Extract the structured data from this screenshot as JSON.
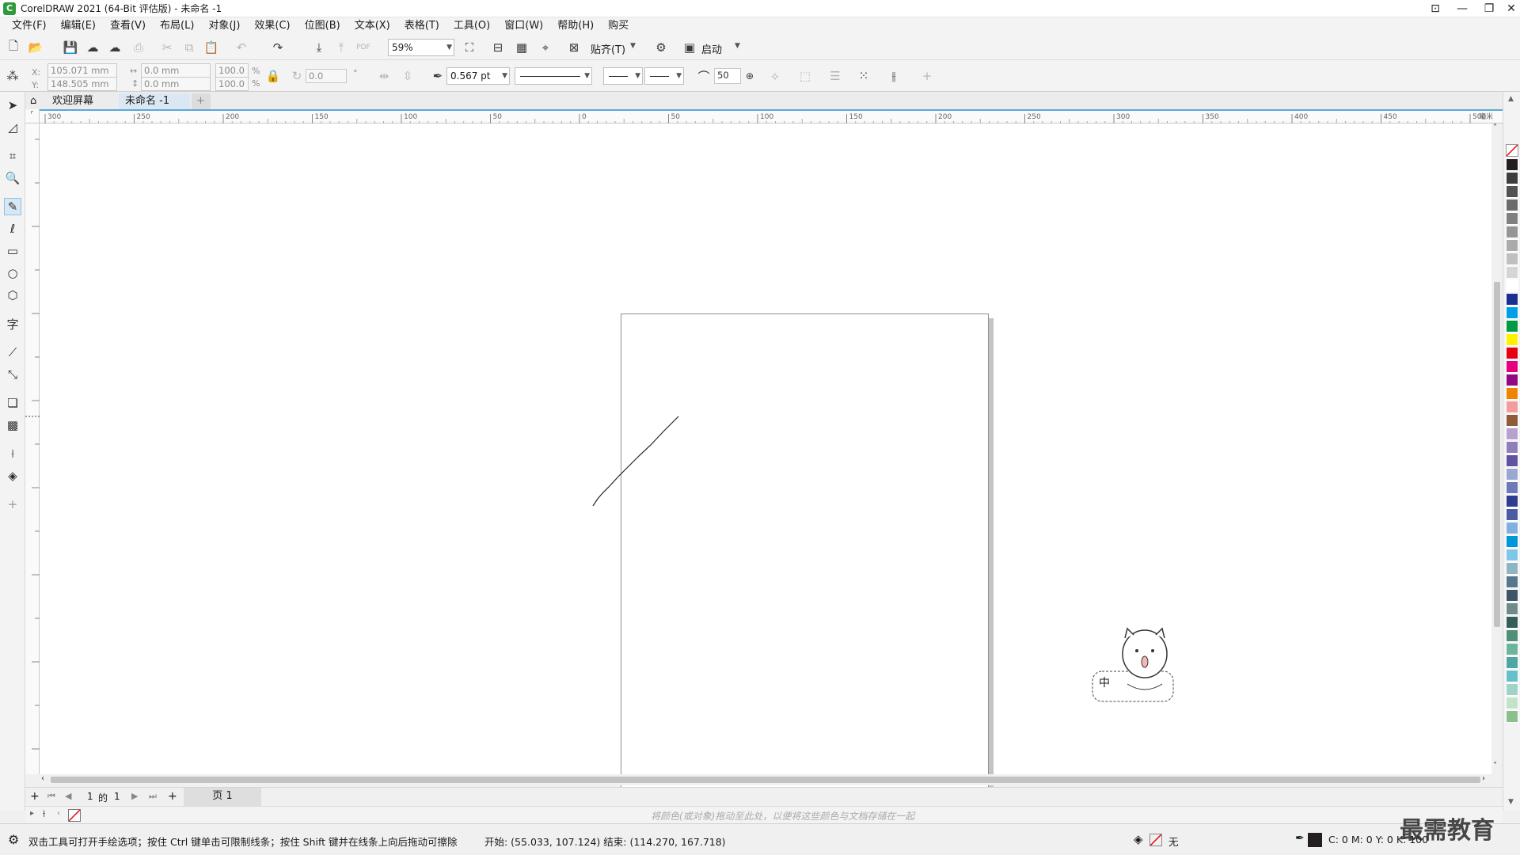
{
  "window": {
    "title": "CorelDRAW 2021 (64-Bit 评估版) - 未命名 -1",
    "min_icon": "minimize-icon",
    "max_icon": "restore-icon",
    "close_icon": "close-icon"
  },
  "menu": [
    "文件(F)",
    "编辑(E)",
    "查看(V)",
    "布局(L)",
    "对象(J)",
    "效果(C)",
    "位图(B)",
    "文本(X)",
    "表格(T)",
    "工具(O)",
    "窗口(W)",
    "帮助(H)",
    "购买"
  ],
  "toolbar": {
    "zoom": "59%",
    "snap_label": "贴齐(T)",
    "launch_label": "启动"
  },
  "property_bar": {
    "x": "105.071 mm",
    "y": "148.505 mm",
    "w": "0.0 mm",
    "h": "0.0 mm",
    "scale_x": "100.0",
    "scale_y": "100.0",
    "pct": "%",
    "rotation": "0.0",
    "outline_width": "0.567 pt",
    "smoothing": "50",
    "x_label": "X:",
    "y_label": "Y:"
  },
  "tabs": {
    "welcome": "欢迎屏幕",
    "document": "未命名 -1"
  },
  "ruler": {
    "h_ticks": [
      "300",
      "250",
      "200",
      "150",
      "100",
      "50",
      "0",
      "50",
      "100",
      "150",
      "200",
      "250",
      "300",
      "350",
      "400",
      "450",
      "500"
    ],
    "unit": "毫米"
  },
  "page_nav": {
    "current": "1",
    "of": "的",
    "total": "1",
    "page_tab": "页 1"
  },
  "doc_palette_hint": "将颜色(或对象)拖动至此处，以便将这些颜色与文档存储在一起",
  "status": {
    "hint": "双击工具可打开手绘选项；按住 Ctrl 键单击可限制线条；按住 Shift 键并在线条上向后拖动可擦除",
    "coords": "开始:  (55.033, 107.124)  结束:  (114.270, 167.718)",
    "fill_label": "无",
    "cmyk": "C: 0 M: 0 Y: 0 K: 100"
  },
  "watermark": "最需教育",
  "ime_badge": "中",
  "colors": {
    "accent": "#5aa9d8",
    "palette": [
      "#231f20",
      "#3d3d3d",
      "#525252",
      "#6b6b6b",
      "#808080",
      "#959595",
      "#ababab",
      "#c0c0c0",
      "#d5d5d5",
      "#ffffff",
      "#1a2f8f",
      "#00a0e9",
      "#009944",
      "#fff100",
      "#e60012",
      "#e4007f",
      "#920783",
      "#f08300",
      "#f29c9f",
      "#8f5b3a",
      "#b7a2cf",
      "#8e7fb8",
      "#5f52a0",
      "#9aa7d1",
      "#6d7ab8",
      "#2e3d8f",
      "#4d5aa3",
      "#7fb0de",
      "#0097d8",
      "#7ec7ea",
      "#8fb5c4",
      "#56788a",
      "#3d5566",
      "#6f8c8a",
      "#355e5a",
      "#4f8f78",
      "#6bb59b",
      "#4fa6a3",
      "#64c0c9",
      "#9ed3c6",
      "#c3e3c8",
      "#8dbf8c"
    ]
  }
}
